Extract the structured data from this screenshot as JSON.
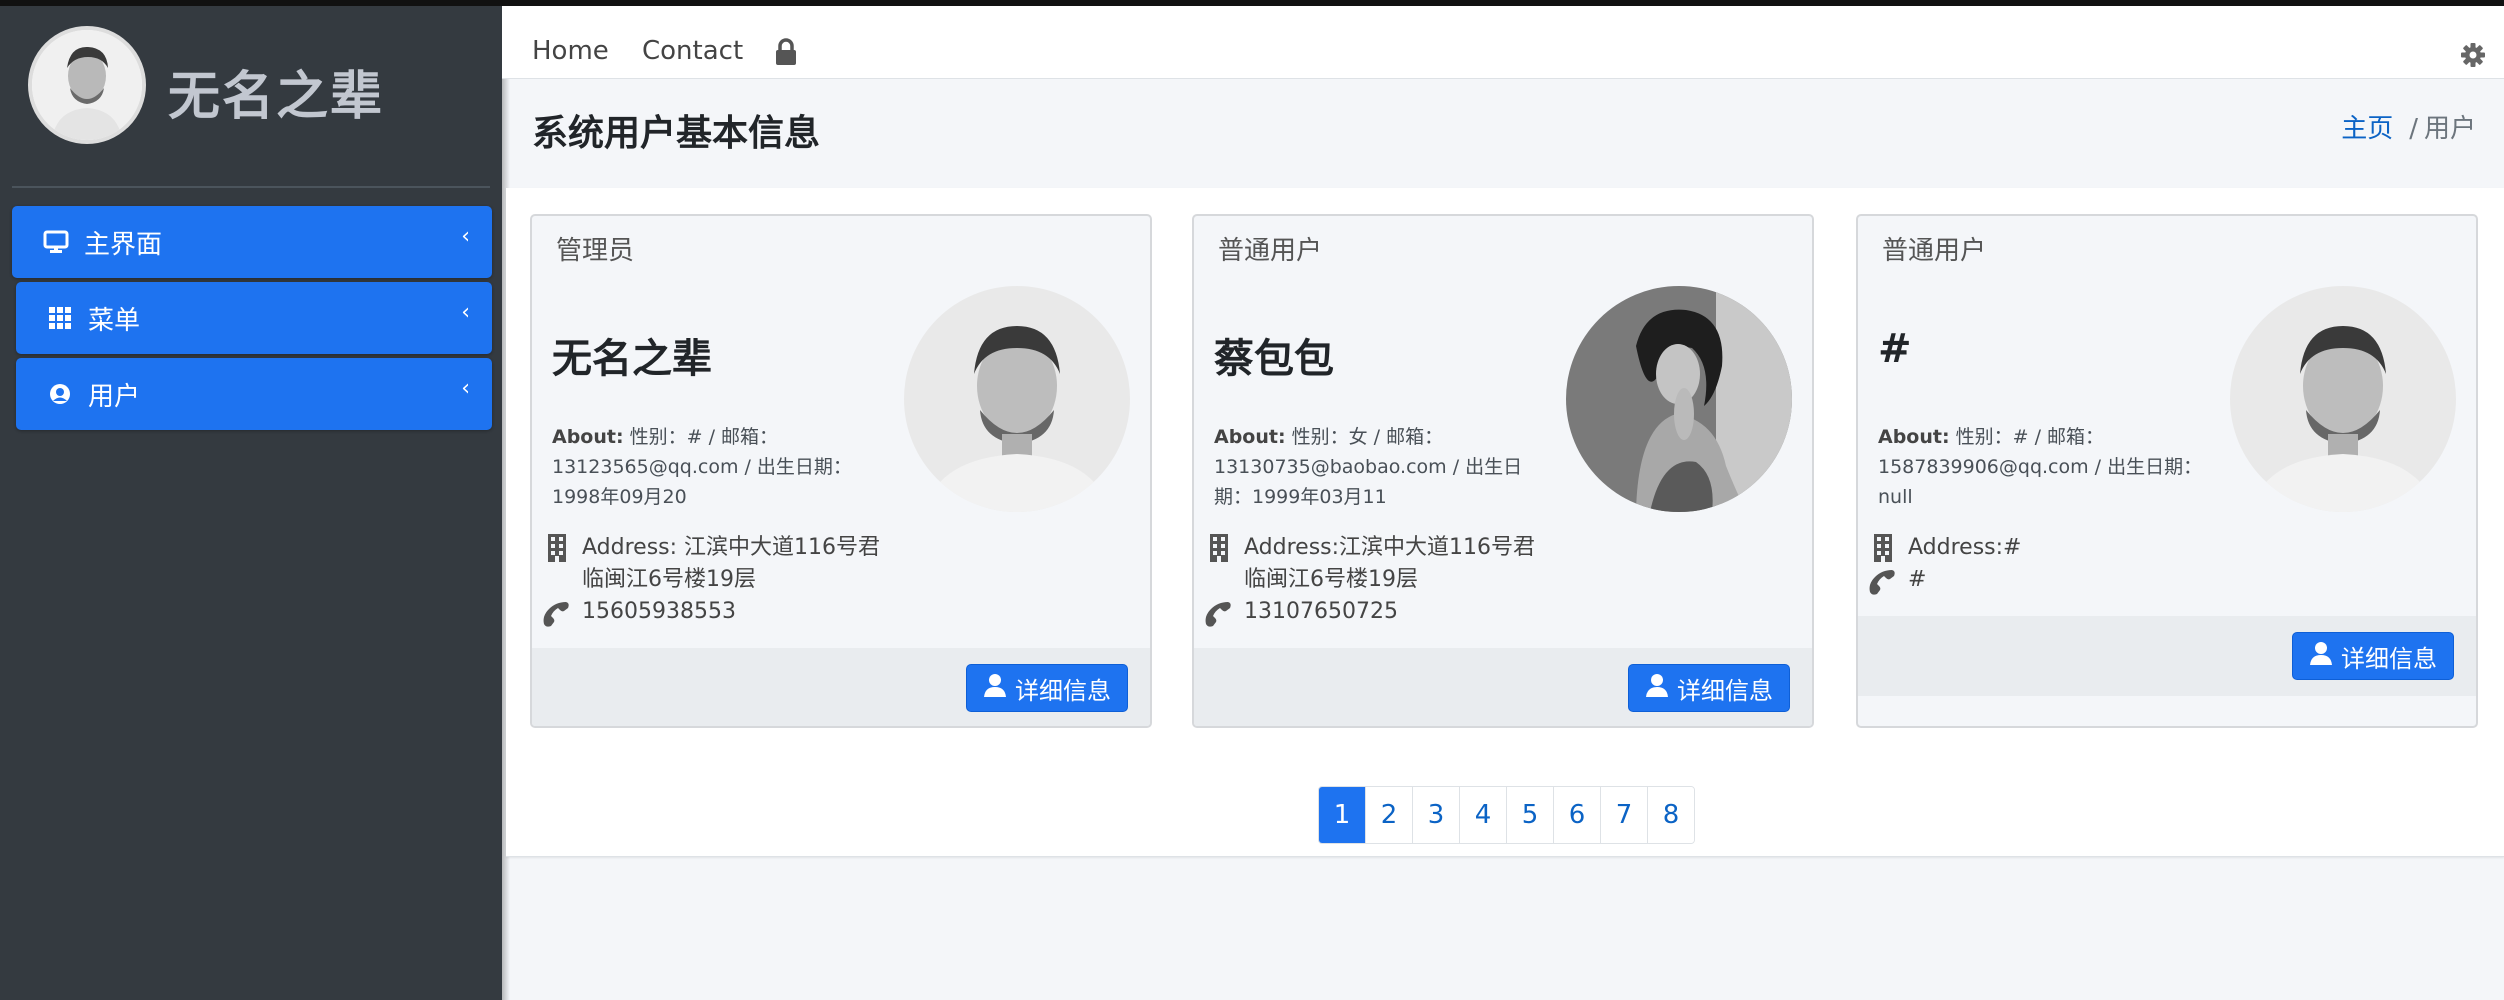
{
  "sidebar": {
    "brand_name": "无名之辈",
    "items": [
      {
        "label": "主界面",
        "icon": "desktop-icon"
      },
      {
        "label": "菜单",
        "icon": "grid-icon"
      },
      {
        "label": "用户",
        "icon": "user-circle-icon"
      }
    ]
  },
  "topnav": {
    "home": "Home",
    "contact": "Contact",
    "lock_icon": "lock-icon",
    "settings_icon": "gear-icon"
  },
  "header": {
    "title": "系统用户基本信息",
    "breadcrumb_home": "主页",
    "breadcrumb_sep": "/",
    "breadcrumb_current": "用户"
  },
  "cards": [
    {
      "role": "管理员",
      "name": "无名之辈",
      "about_label": "About:",
      "about_text": "性别：# / 邮箱：13123565@qq.com / 出生日期：1998年09月20",
      "address": "Address: 江滨中大道116号君临闽江6号楼19层",
      "phone": "15605938553",
      "button": "详细信息"
    },
    {
      "role": "普通用户",
      "name": "蔡包包",
      "about_label": "About:",
      "about_text": "性别：女 / 邮箱：13130735@baobao.com / 出生日期：1999年03月11",
      "address": "Address:江滨中大道116号君临闽江6号楼19层",
      "phone": "13107650725",
      "button": "详细信息"
    },
    {
      "role": "普通用户",
      "name": "#",
      "about_label": "About:",
      "about_text": "性别：# / 邮箱：1587839906@qq.com / 出生日期：null",
      "address": "Address:#",
      "phone": "#",
      "button": "详细信息"
    }
  ],
  "pagination": {
    "pages": [
      "1",
      "2",
      "3",
      "4",
      "5",
      "6",
      "7",
      "8"
    ],
    "active": "1"
  },
  "colors": {
    "sidebar_bg": "#343a40",
    "accent": "#1e73f0",
    "link": "#0b63c5"
  }
}
